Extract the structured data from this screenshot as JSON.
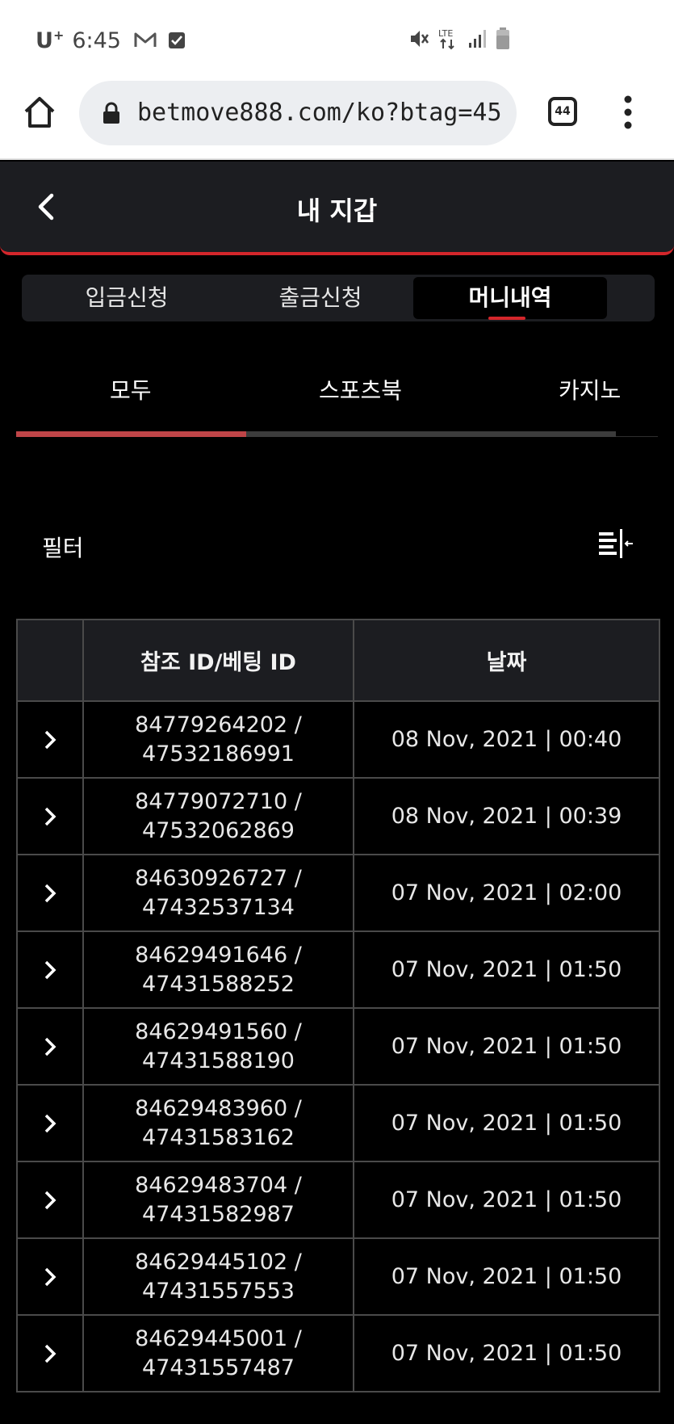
{
  "status_bar": {
    "carrier": "U",
    "carrier_sup": "+",
    "time": "6:45",
    "icons": [
      "mail-icon",
      "check-icon",
      "mute-icon",
      "lte-icon",
      "signal-icon",
      "battery-icon"
    ],
    "lte_label": "LTE"
  },
  "browser": {
    "url": "betmove888.com/ko?btag=45",
    "tab_count": "44"
  },
  "header": {
    "title": "내 지갑"
  },
  "main_tabs": [
    {
      "label": "입금신청",
      "active": false
    },
    {
      "label": "출금신청",
      "active": false
    },
    {
      "label": "머니내역",
      "active": true
    }
  ],
  "sub_tabs": [
    {
      "label": "모두",
      "active": true
    },
    {
      "label": "스포츠북",
      "active": false
    },
    {
      "label": "카지노",
      "active": false
    }
  ],
  "filter": {
    "label": "필터"
  },
  "table": {
    "headers": [
      "",
      "참조 ID/베팅 ID",
      "날짜"
    ],
    "rows": [
      {
        "ref_id": "84779264202 /",
        "bet_id": "47532186991",
        "date": "08 Nov, 2021 | 00:40"
      },
      {
        "ref_id": "84779072710 /",
        "bet_id": "47532062869",
        "date": "08 Nov, 2021 | 00:39"
      },
      {
        "ref_id": "84630926727 /",
        "bet_id": "47432537134",
        "date": "07 Nov, 2021 | 02:00"
      },
      {
        "ref_id": "84629491646 /",
        "bet_id": "47431588252",
        "date": "07 Nov, 2021 | 01:50"
      },
      {
        "ref_id": "84629491560 /",
        "bet_id": "47431588190",
        "date": "07 Nov, 2021 | 01:50"
      },
      {
        "ref_id": "84629483960 /",
        "bet_id": "47431583162",
        "date": "07 Nov, 2021 | 01:50"
      },
      {
        "ref_id": "84629483704 /",
        "bet_id": "47431582987",
        "date": "07 Nov, 2021 | 01:50"
      },
      {
        "ref_id": "84629445102 /",
        "bet_id": "47431557553",
        "date": "07 Nov, 2021 | 01:50"
      },
      {
        "ref_id": "84629445001 /",
        "bet_id": "47431557487",
        "date": "07 Nov, 2021 | 01:50"
      }
    ]
  },
  "colors": {
    "accent": "#d4262b",
    "panel": "#1c1d21",
    "background": "#000000",
    "border": "#4a4a4a"
  }
}
